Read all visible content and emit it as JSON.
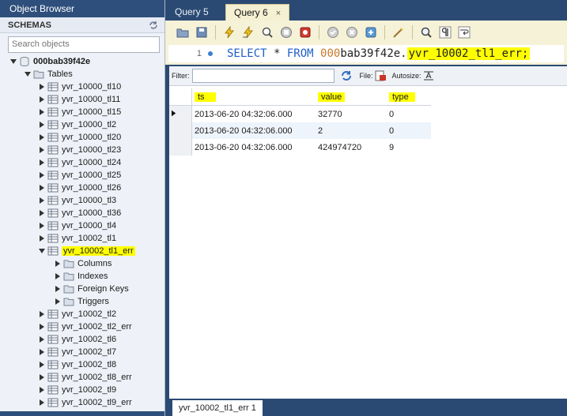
{
  "object_browser": {
    "title": "Object Browser",
    "schemas_label": "SCHEMAS",
    "search_placeholder": "Search objects",
    "schema_name": "000bab39f42e",
    "tables_label": "Tables",
    "tables_before": [
      "yvr_10000_tl10",
      "yvr_10000_tl11",
      "yvr_10000_tl15",
      "yvr_10000_tl2",
      "yvr_10000_tl20",
      "yvr_10000_tl23",
      "yvr_10000_tl24",
      "yvr_10000_tl25",
      "yvr_10000_tl26",
      "yvr_10000_tl3",
      "yvr_10000_tl36",
      "yvr_10000_tl4",
      "yvr_10002_tl1"
    ],
    "expanded_table": "yvr_10002_tl1_err",
    "expanded_children": [
      "Columns",
      "Indexes",
      "Foreign Keys",
      "Triggers"
    ],
    "tables_after": [
      "yvr_10002_tl2",
      "yvr_10002_tl2_err",
      "yvr_10002_tl6",
      "yvr_10002_tl7",
      "yvr_10002_tl8",
      "yvr_10002_tl8_err",
      "yvr_10002_tl9",
      "yvr_10002_tl9_err"
    ]
  },
  "tabs": [
    "Query 5",
    "Query 6"
  ],
  "active_tab": "Query 6",
  "tab_close": "×",
  "editor": {
    "line_number": "1",
    "sql_keyword_select": "SELECT",
    "sql_star": " * ",
    "sql_keyword_from": "FROM",
    "sql_schema_prefix": "000",
    "sql_schema_rest": "bab39f42e.",
    "sql_table": "yvr_10002_tl1_err;"
  },
  "result": {
    "filter_label": "Filter:",
    "file_label": "File:",
    "autosize_label": "Autosize:",
    "columns": [
      "ts",
      "value",
      "type"
    ],
    "rows": [
      [
        "2013-06-20 04:32:06.000",
        "32770",
        "0"
      ],
      [
        "2013-06-20 04:32:06.000",
        "2",
        "0"
      ],
      [
        "2013-06-20 04:32:06.000",
        "424974720",
        "9"
      ]
    ],
    "result_tab": "yvr_10002_tl1_err 1"
  },
  "colors": {
    "highlight": "#ffff00",
    "sql_keyword": "#1f5fc8",
    "header_bg": "#2e4f7b"
  }
}
